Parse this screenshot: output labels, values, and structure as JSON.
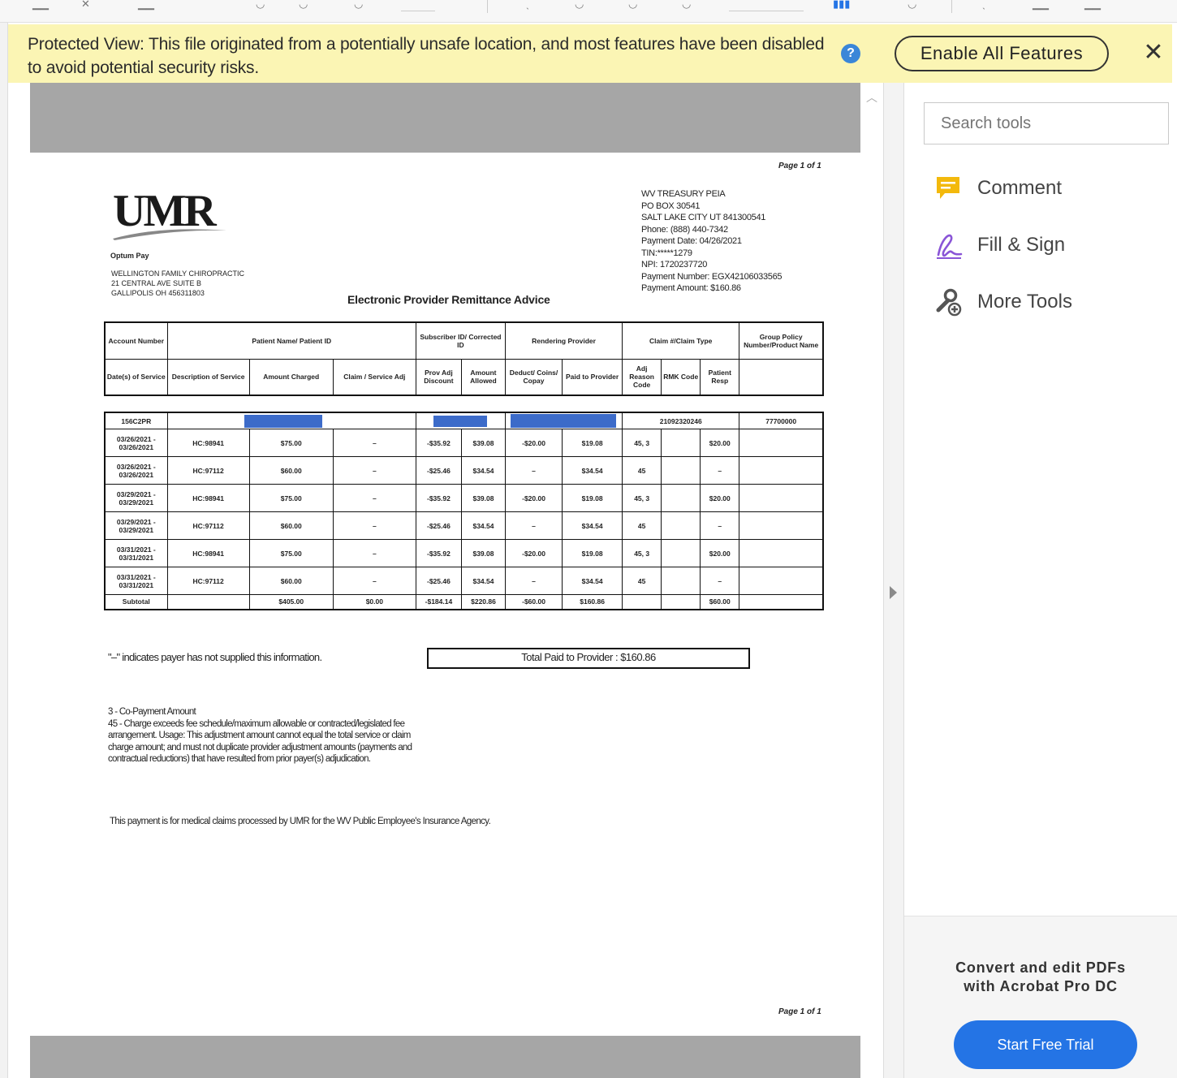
{
  "protected_view": {
    "message_line1": "Protected View: This file originated from a potentially unsafe location, and most features have been disabled",
    "message_line2": "to avoid potential security risks.",
    "enable_button": "Enable All Features",
    "close_icon": "close-icon",
    "help_icon": "help-icon"
  },
  "document": {
    "page_label_top": "Page 1 of 1",
    "page_label_bottom": "Page 1 of 1",
    "logo_text": "UMR",
    "optum_label": "Optum Pay",
    "provider_address": [
      "WELLINGTON FAMILY CHIROPRACTIC",
      "21 CENTRAL AVE SUITE B",
      "GALLIPOLIS  OH  456311803"
    ],
    "payer_address": [
      "WV TREASURY PEIA",
      "PO BOX 30541",
      "SALT LAKE CITY  UT  841300541",
      "Phone: (888) 440-7342",
      "Payment Date: 04/26/2021",
      "TIN:*****1279",
      "NPI: 1720237720",
      "Payment Number: EGX42106033565",
      "Payment Amount: $160.86"
    ],
    "title": "Electronic Provider Remittance Advice",
    "header_row1": [
      "Account Number",
      "Patient Name/ Patient ID",
      "Subscriber ID/ Corrected ID",
      "Rendering Provider",
      "Claim #/Claim Type",
      "Group Policy Number/Product Name"
    ],
    "header_row2": [
      "Date(s) of Service",
      "Description of Service",
      "Amount Charged",
      "Claim / Service Adj",
      "Prov Adj Discount",
      "Amount Allowed",
      "Deduct/ Coins/ Copay",
      "Paid to Provider",
      "Adj Reason Code",
      "RMK Code",
      "Patient Resp"
    ],
    "account": {
      "number": "156C2PR",
      "claim_number": "21092320246",
      "group_policy": "77700000"
    },
    "rows": [
      [
        "03/26/2021 - 03/26/2021",
        "HC:98941",
        "$75.00",
        "–",
        "-$35.92",
        "$39.08",
        "-$20.00",
        "$19.08",
        "45, 3",
        "",
        "$20.00"
      ],
      [
        "03/26/2021 - 03/26/2021",
        "HC:97112",
        "$60.00",
        "–",
        "-$25.46",
        "$34.54",
        "–",
        "$34.54",
        "45",
        "",
        "–"
      ],
      [
        "03/29/2021 - 03/29/2021",
        "HC:98941",
        "$75.00",
        "–",
        "-$35.92",
        "$39.08",
        "-$20.00",
        "$19.08",
        "45, 3",
        "",
        "$20.00"
      ],
      [
        "03/29/2021 - 03/29/2021",
        "HC:97112",
        "$60.00",
        "–",
        "-$25.46",
        "$34.54",
        "–",
        "$34.54",
        "45",
        "",
        "–"
      ],
      [
        "03/31/2021 - 03/31/2021",
        "HC:98941",
        "$75.00",
        "–",
        "-$35.92",
        "$39.08",
        "-$20.00",
        "$19.08",
        "45, 3",
        "",
        "$20.00"
      ],
      [
        "03/31/2021 - 03/31/2021",
        "HC:97112",
        "$60.00",
        "–",
        "-$25.46",
        "$34.54",
        "–",
        "$34.54",
        "45",
        "",
        "–"
      ]
    ],
    "subtotal": [
      "Subtotal",
      "",
      "$405.00",
      "$0.00",
      "-$184.14",
      "$220.86",
      "-$60.00",
      "$160.86",
      "",
      "",
      "$60.00"
    ],
    "dash_note": "\"–\" indicates payer has not supplied this information.",
    "total_paid": "Total Paid to Provider : $160.86",
    "reasons": [
      "3 - Co-Payment Amount",
      "45 - Charge exceeds fee schedule/maximum allowable or contracted/legislated fee arrangement. Usage: This adjustment amount cannot equal the total service or claim charge amount; and must not duplicate provider adjustment amounts (payments and contractual reductions) that have resulted from prior payer(s) adjudication."
    ],
    "footer_note": "This payment is for medical claims processed by UMR for the WV Public Employee's Insurance Agency."
  },
  "tools_panel": {
    "search_placeholder": "Search tools",
    "items": [
      {
        "label": "Comment",
        "icon": "comment-icon",
        "color": "#f3b90c"
      },
      {
        "label": "Fill & Sign",
        "icon": "fill-sign-icon",
        "color": "#8a55d7"
      },
      {
        "label": "More Tools",
        "icon": "more-tools-icon",
        "color": "#555555"
      }
    ],
    "promo_line1": "Convert and edit PDFs",
    "promo_line2": "with Acrobat Pro DC",
    "trial_button": "Start Free Trial"
  },
  "colors": {
    "protected_bar": "#fbf5b4",
    "accent_blue": "#2474e5",
    "redaction": "#3c6bc9",
    "page_gray": "#a6a6a6"
  }
}
